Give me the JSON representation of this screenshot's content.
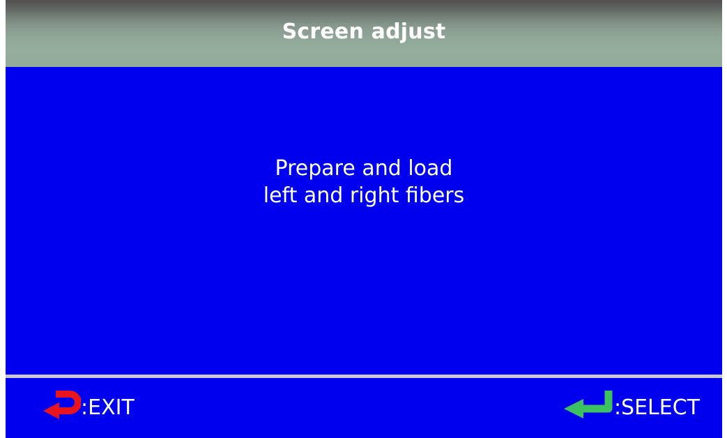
{
  "title": "Screen adjust",
  "message": {
    "line1": "Prepare and load",
    "line2": "left and right fibers"
  },
  "footer": {
    "exit": {
      "icon": "return-arrow-icon",
      "label": ":EXIT",
      "color": "#e8141e"
    },
    "select": {
      "icon": "enter-arrow-icon",
      "label": ":SELECT",
      "color": "#3cc060"
    }
  },
  "colors": {
    "background": "#0000ee",
    "title_bar": "#93ab9a",
    "divider": "#c8c8d4",
    "text": "#ffffff"
  }
}
